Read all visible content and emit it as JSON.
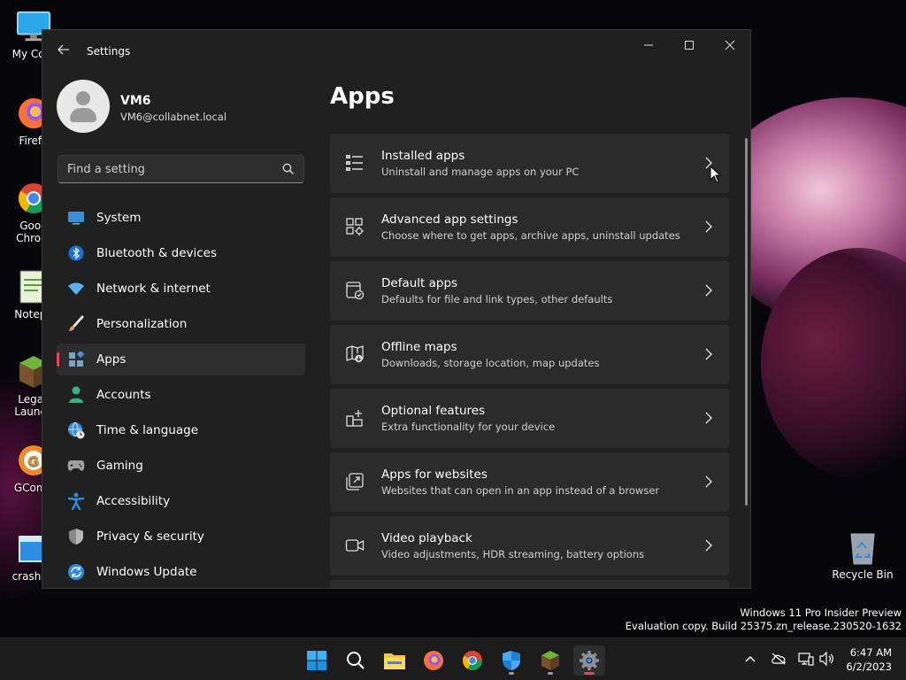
{
  "desktop": {
    "icons": [
      {
        "label": "My Com"
      },
      {
        "label": "Firefo"
      },
      {
        "label": "Goog\nChrom"
      },
      {
        "label": "Notepa"
      },
      {
        "label": "Legac\nLaunch"
      },
      {
        "label": "GComp"
      },
      {
        "label": "crash th"
      }
    ],
    "recycle_bin": "Recycle Bin"
  },
  "window": {
    "title": "Settings",
    "controls": {
      "minimize": "—",
      "maximize": "☐",
      "close": "✕"
    }
  },
  "profile": {
    "name": "VM6",
    "email": "VM6@collabnet.local"
  },
  "search": {
    "placeholder": "Find a setting"
  },
  "nav": {
    "items": [
      {
        "label": "System",
        "icon": "monitor-icon",
        "color": "#3a8fd8"
      },
      {
        "label": "Bluetooth & devices",
        "icon": "bluetooth-icon",
        "color": "#1b73d8"
      },
      {
        "label": "Network & internet",
        "icon": "wifi-icon",
        "color": "#5ab0f0"
      },
      {
        "label": "Personalization",
        "icon": "brush-icon",
        "color": "#e0a060"
      },
      {
        "label": "Apps",
        "icon": "apps-icon",
        "color": "#7aa3c8"
      },
      {
        "label": "Accounts",
        "icon": "person-icon",
        "color": "#2fb58a"
      },
      {
        "label": "Time & language",
        "icon": "globe-clock-icon",
        "color": "#3a8fd8"
      },
      {
        "label": "Gaming",
        "icon": "gamepad-icon",
        "color": "#9a9a9a"
      },
      {
        "label": "Accessibility",
        "icon": "accessibility-icon",
        "color": "#2a8fe0"
      },
      {
        "label": "Privacy & security",
        "icon": "shield-icon",
        "color": "#8a8a8a"
      },
      {
        "label": "Windows Update",
        "icon": "update-icon",
        "color": "#2a8fe0"
      }
    ],
    "selected_index": 4
  },
  "main": {
    "title": "Apps",
    "cards": [
      {
        "title": "Installed apps",
        "subtitle": "Uninstall and manage apps on your PC",
        "icon": "list-icon"
      },
      {
        "title": "Advanced app settings",
        "subtitle": "Choose where to get apps, archive apps, uninstall updates",
        "icon": "apps-gear-icon"
      },
      {
        "title": "Default apps",
        "subtitle": "Defaults for file and link types, other defaults",
        "icon": "default-apps-icon"
      },
      {
        "title": "Offline maps",
        "subtitle": "Downloads, storage location, map updates",
        "icon": "map-icon"
      },
      {
        "title": "Optional features",
        "subtitle": "Extra functionality for your device",
        "icon": "grid-plus-icon"
      },
      {
        "title": "Apps for websites",
        "subtitle": "Websites that can open in an app instead of a browser",
        "icon": "open-link-icon"
      },
      {
        "title": "Video playback",
        "subtitle": "Video adjustments, HDR streaming, battery options",
        "icon": "video-icon"
      }
    ]
  },
  "watermark": {
    "line1": "Windows 11 Pro Insider Preview",
    "line2": "Evaluation copy. Build 25375.zn_release.230520-1632"
  },
  "taskbar": {
    "apps": [
      "start-icon",
      "search-icon",
      "file-explorer-icon",
      "firefox-icon",
      "chrome-icon",
      "defender-icon",
      "minecraft-launcher-icon",
      "settings-icon"
    ],
    "active_app": "settings-icon",
    "tray": [
      "chevron-up-icon",
      "onedrive-icon",
      "network-icon",
      "volume-icon"
    ],
    "time": "6:47 AM",
    "date": "6/2/2023"
  },
  "colors": {
    "accent": "#e8435a",
    "window_bg": "#202020",
    "card_bg": "#2b2b2b"
  }
}
